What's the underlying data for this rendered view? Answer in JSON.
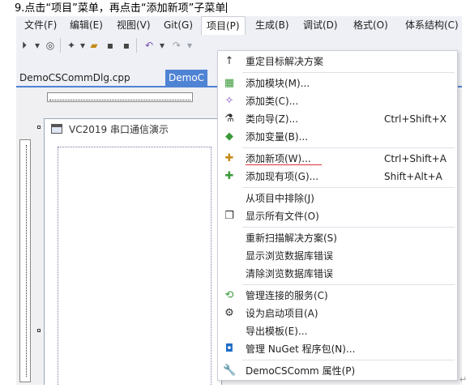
{
  "caption": "9.点击“项目”菜单，再点击“添加新项”子菜单",
  "menubar": {
    "file": "文件(F)",
    "edit": "编辑(E)",
    "view": "视图(V)",
    "git": "Git(G)",
    "project": "项目(P)",
    "build": "生成(B)",
    "debug": "调试(D)",
    "format": "格式(O)",
    "arch": "体系结构(C)"
  },
  "tabs": {
    "cpp": "DemoCSCommDlg.cpp",
    "selected": "DemoC"
  },
  "dialog": {
    "title": "VC2019 串口通信演示"
  },
  "project_menu": {
    "retarget": "重定目标解决方案",
    "add_module": "添加模块(M)...",
    "add_class": "添加类(C)...",
    "class_wizard": "类向导(Z)...",
    "class_wizard_shortcut": "Ctrl+Shift+X",
    "add_variable": "添加变量(B)...",
    "add_new_item": "添加新项(W)...",
    "add_new_item_shortcut": "Ctrl+Shift+A",
    "add_existing_item": "添加现有项(G)...",
    "add_existing_item_shortcut": "Shift+Alt+A",
    "exclude": "从项目中排除(J)",
    "show_all_files": "显示所有文件(O)",
    "rescan": "重新扫描解决方案(S)",
    "show_db_errors": "显示浏览数据库错误",
    "clear_db_errors": "清除浏览数据库错误",
    "connected_services": "管理连接的服务(C)",
    "set_startup": "设为启动项目(A)",
    "export_template": "导出模板(E)...",
    "nuget": "管理 NuGet 程序包(N)...",
    "properties": "DemoCSComm 属性(P)"
  },
  "colors": {
    "accent": "#4f83d4",
    "menu_bg": "#eef0f5",
    "highlight_underline": "#e03030"
  }
}
